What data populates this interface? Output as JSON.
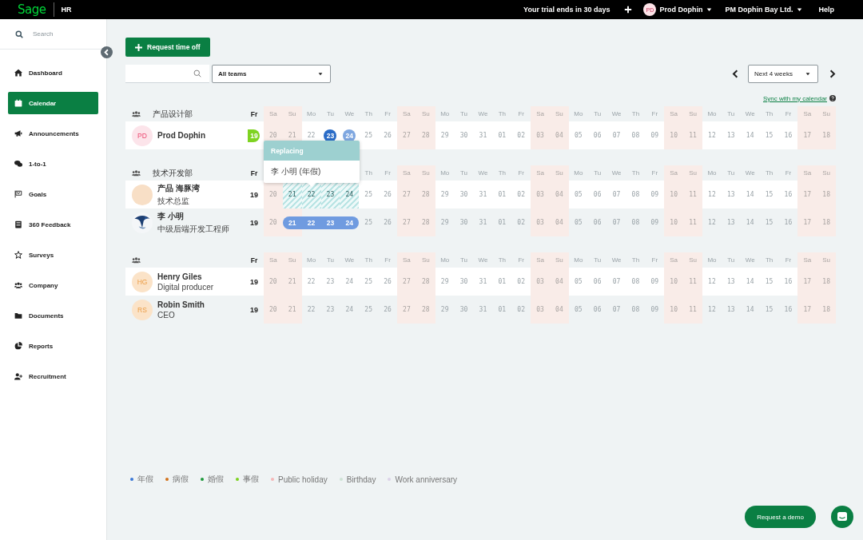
{
  "topbar": {
    "logo": "Sage",
    "product": "HR",
    "trial": "Your trial ends in 30 days",
    "user": {
      "initials": "PD",
      "name": "Prod Dophin"
    },
    "company": "PM Dophin Bay Ltd.",
    "help": "Help"
  },
  "sidebar": {
    "search_placeholder": "Search",
    "items": [
      {
        "label": "Dashboard",
        "kind": "home",
        "selected": false
      },
      {
        "label": "Calendar",
        "kind": "calendar",
        "selected": true
      },
      {
        "label": "Announcements",
        "kind": "megaphone",
        "selected": false
      },
      {
        "label": "1-to-1",
        "kind": "chat",
        "selected": false
      },
      {
        "label": "Goals",
        "kind": "flag",
        "selected": false
      },
      {
        "label": "360 Feedback",
        "kind": "doc",
        "selected": false
      },
      {
        "label": "Surveys",
        "kind": "star",
        "selected": false
      },
      {
        "label": "Company",
        "kind": "people",
        "selected": false
      },
      {
        "label": "Documents",
        "kind": "folder",
        "selected": false
      },
      {
        "label": "Reports",
        "kind": "pie",
        "selected": false
      },
      {
        "label": "Recruitment",
        "kind": "adduser",
        "selected": false
      }
    ]
  },
  "toolbar": {
    "request_button": "Request time off",
    "team_select": "All teams",
    "range_select": "Next 4 weeks",
    "sync_link": "Sync with my calendar"
  },
  "teams": [
    {
      "name": "产品设计部",
      "weekdays": [
        {
          "label": "Fr",
          "weekend": false,
          "today": true
        },
        {
          "label": "Sa",
          "weekend": true,
          "today": false
        },
        {
          "label": "Su",
          "weekend": true,
          "today": false
        },
        {
          "label": "Mo",
          "weekend": false,
          "today": false
        },
        {
          "label": "Tu",
          "weekend": false,
          "today": false
        },
        {
          "label": "We",
          "weekend": false,
          "today": false
        },
        {
          "label": "Th",
          "weekend": false,
          "today": false
        },
        {
          "label": "Fr",
          "weekend": false,
          "today": false
        },
        {
          "label": "Sa",
          "weekend": true,
          "today": false
        },
        {
          "label": "Su",
          "weekend": true,
          "today": false
        },
        {
          "label": "Mo",
          "weekend": false,
          "today": false
        },
        {
          "label": "Tu",
          "weekend": false,
          "today": false
        },
        {
          "label": "We",
          "weekend": false,
          "today": false
        },
        {
          "label": "Th",
          "weekend": false,
          "today": false
        },
        {
          "label": "Fr",
          "weekend": false,
          "today": false
        },
        {
          "label": "Sa",
          "weekend": true,
          "today": false
        },
        {
          "label": "Su",
          "weekend": true,
          "today": false
        },
        {
          "label": "Mo",
          "weekend": false,
          "today": false
        },
        {
          "label": "Tu",
          "weekend": false,
          "today": false
        },
        {
          "label": "We",
          "weekend": false,
          "today": false
        },
        {
          "label": "Th",
          "weekend": false,
          "today": false
        },
        {
          "label": "Fr",
          "weekend": false,
          "today": false
        },
        {
          "label": "Sa",
          "weekend": true,
          "today": false
        },
        {
          "label": "Su",
          "weekend": true,
          "today": false
        },
        {
          "label": "Mo",
          "weekend": false,
          "today": false
        },
        {
          "label": "Tu",
          "weekend": false,
          "today": false
        },
        {
          "label": "We",
          "weekend": false,
          "today": false
        },
        {
          "label": "Th",
          "weekend": false,
          "today": false
        },
        {
          "label": "Fr",
          "weekend": false,
          "today": false
        },
        {
          "label": "Sa",
          "weekend": true,
          "today": false
        },
        {
          "label": "Su",
          "weekend": true,
          "today": false
        }
      ],
      "members": [
        {
          "name": "Prod Dophin",
          "avatar": {
            "kind": "initials",
            "initials": "PD",
            "color": "#fce4ea"
          },
          "days": [
            {
              "date": "19",
              "kind": "half",
              "color": "#7ed321"
            },
            {
              "date": "20",
              "kind": "plain"
            },
            {
              "date": "21",
              "kind": "plain"
            },
            {
              "date": "22",
              "kind": "plain"
            },
            {
              "date": "23",
              "kind": "circle",
              "color": "#2a6cc7"
            },
            {
              "date": "24",
              "kind": "circle",
              "color": "#7fa7e0"
            },
            {
              "date": "25",
              "kind": "plain"
            },
            {
              "date": "26",
              "kind": "plain"
            },
            {
              "date": "27",
              "kind": "plain"
            },
            {
              "date": "28",
              "kind": "plain"
            },
            {
              "date": "29",
              "kind": "plain"
            },
            {
              "date": "30",
              "kind": "plain"
            },
            {
              "date": "31",
              "kind": "plain"
            },
            {
              "date": "01",
              "kind": "plain"
            },
            {
              "date": "02",
              "kind": "plain"
            },
            {
              "date": "03",
              "kind": "plain"
            },
            {
              "date": "04",
              "kind": "plain"
            },
            {
              "date": "05",
              "kind": "plain"
            },
            {
              "date": "06",
              "kind": "plain"
            },
            {
              "date": "07",
              "kind": "plain"
            },
            {
              "date": "08",
              "kind": "plain"
            },
            {
              "date": "09",
              "kind": "plain"
            },
            {
              "date": "10",
              "kind": "plain"
            },
            {
              "date": "11",
              "kind": "plain"
            },
            {
              "date": "12",
              "kind": "plain"
            },
            {
              "date": "13",
              "kind": "plain"
            },
            {
              "date": "14",
              "kind": "plain"
            },
            {
              "date": "15",
              "kind": "plain"
            },
            {
              "date": "16",
              "kind": "plain"
            },
            {
              "date": "17",
              "kind": "plain"
            },
            {
              "date": "18",
              "kind": "plain"
            }
          ]
        }
      ]
    },
    {
      "name": "技术开发部",
      "weekdays": [
        {
          "label": "Fr",
          "weekend": false,
          "today": true
        },
        {
          "label": "Th",
          "weekend": false,
          "today": false
        },
        {
          "label": "Fr",
          "weekend": false,
          "today": false
        },
        {
          "label": "Sa",
          "weekend": true,
          "today": false
        },
        {
          "label": "Su",
          "weekend": true,
          "today": false
        },
        {
          "label": "Mo",
          "weekend": false,
          "today": false
        },
        {
          "label": "Tu",
          "weekend": false,
          "today": false
        },
        {
          "label": "We",
          "weekend": false,
          "today": false
        },
        {
          "label": "Th",
          "weekend": false,
          "today": false
        },
        {
          "label": "Fr",
          "weekend": false,
          "today": false
        },
        {
          "label": "Sa",
          "weekend": true,
          "today": false
        },
        {
          "label": "Su",
          "weekend": true,
          "today": false
        },
        {
          "label": "Mo",
          "weekend": false,
          "today": false
        },
        {
          "label": "Tu",
          "weekend": false,
          "today": false
        },
        {
          "label": "We",
          "weekend": false,
          "today": false
        },
        {
          "label": "Th",
          "weekend": false,
          "today": false
        },
        {
          "label": "Fr",
          "weekend": false,
          "today": false
        },
        {
          "label": "Sa",
          "weekend": true,
          "today": false
        },
        {
          "label": "Su",
          "weekend": true,
          "today": false
        },
        {
          "label": "Mo",
          "weekend": false,
          "today": false
        },
        {
          "label": "Tu",
          "weekend": false,
          "today": false
        },
        {
          "label": "We",
          "weekend": false,
          "today": false
        },
        {
          "label": "Th",
          "weekend": false,
          "today": false
        },
        {
          "label": "Fr",
          "weekend": false,
          "today": false
        },
        {
          "label": "Sa",
          "weekend": true,
          "today": false
        },
        {
          "label": "Su",
          "weekend": true,
          "today": false
        }
      ],
      "members": [
        {
          "name": "产品 海豚湾",
          "role": "技术总监",
          "avatar": {
            "kind": "blank",
            "color": "#f8dfc6"
          },
          "days": [
            {
              "date": "19",
              "kind": "plain"
            },
            {
              "date": "20",
              "kind": "plain"
            },
            {
              "date": "21",
              "kind": "replacing"
            },
            {
              "date": "22",
              "kind": "replacing"
            },
            {
              "date": "23",
              "kind": "replacing"
            },
            {
              "date": "24",
              "kind": "replacing"
            },
            {
              "date": "25",
              "kind": "plain"
            },
            {
              "date": "26",
              "kind": "plain"
            },
            {
              "date": "27",
              "kind": "plain"
            },
            {
              "date": "28",
              "kind": "plain"
            },
            {
              "date": "29",
              "kind": "plain"
            },
            {
              "date": "30",
              "kind": "plain"
            },
            {
              "date": "31",
              "kind": "plain"
            },
            {
              "date": "01",
              "kind": "plain"
            },
            {
              "date": "02",
              "kind": "plain"
            },
            {
              "date": "03",
              "kind": "plain"
            },
            {
              "date": "04",
              "kind": "plain"
            },
            {
              "date": "05",
              "kind": "plain"
            },
            {
              "date": "06",
              "kind": "plain"
            },
            {
              "date": "07",
              "kind": "plain"
            },
            {
              "date": "08",
              "kind": "plain"
            },
            {
              "date": "09",
              "kind": "plain"
            },
            {
              "date": "10",
              "kind": "plain"
            },
            {
              "date": "11",
              "kind": "plain"
            },
            {
              "date": "12",
              "kind": "plain"
            },
            {
              "date": "13",
              "kind": "plain"
            },
            {
              "date": "14",
              "kind": "plain"
            },
            {
              "date": "15",
              "kind": "plain"
            },
            {
              "date": "16",
              "kind": "plain"
            },
            {
              "date": "17",
              "kind": "plain"
            },
            {
              "date": "18",
              "kind": "plain"
            }
          ]
        },
        {
          "name": "李 小明",
          "role": "中级后端开发工程师",
          "days": [
            {
              "date": "19",
              "kind": "plain"
            },
            {
              "date": "20",
              "kind": "plain"
            },
            {
              "date": "21",
              "kind": "pill",
              "color": "#6f9be0"
            },
            {
              "date": "22",
              "kind": "pill",
              "color": "#6f9be0"
            },
            {
              "date": "23",
              "kind": "pill",
              "color": "#6f9be0"
            },
            {
              "date": "24",
              "kind": "pill",
              "color": "#6f9be0"
            },
            {
              "date": "25",
              "kind": "plain"
            },
            {
              "date": "26",
              "kind": "plain"
            },
            {
              "date": "27",
              "kind": "plain"
            },
            {
              "date": "28",
              "kind": "plain"
            },
            {
              "date": "29",
              "kind": "plain"
            },
            {
              "date": "30",
              "kind": "plain"
            },
            {
              "date": "31",
              "kind": "plain"
            },
            {
              "date": "01",
              "kind": "plain"
            },
            {
              "date": "02",
              "kind": "plain"
            },
            {
              "date": "03",
              "kind": "plain"
            },
            {
              "date": "04",
              "kind": "plain"
            },
            {
              "date": "05",
              "kind": "plain"
            },
            {
              "date": "06",
              "kind": "plain"
            },
            {
              "date": "07",
              "kind": "plain"
            },
            {
              "date": "08",
              "kind": "plain"
            },
            {
              "date": "09",
              "kind": "plain"
            },
            {
              "date": "10",
              "kind": "plain"
            },
            {
              "date": "11",
              "kind": "plain"
            },
            {
              "date": "12",
              "kind": "plain"
            },
            {
              "date": "13",
              "kind": "plain"
            },
            {
              "date": "14",
              "kind": "plain"
            },
            {
              "date": "15",
              "kind": "plain"
            },
            {
              "date": "16",
              "kind": "plain"
            },
            {
              "date": "17",
              "kind": "plain"
            },
            {
              "date": "18",
              "kind": "plain"
            }
          ]
        }
      ]
    },
    {
      "weekdays": [
        {
          "label": "Fr",
          "weekend": false,
          "today": true
        },
        {
          "label": "Sa",
          "weekend": true,
          "today": false
        },
        {
          "label": "Su",
          "weekend": true,
          "today": false
        },
        {
          "label": "Mo",
          "weekend": false,
          "today": false
        },
        {
          "label": "Tu",
          "weekend": false,
          "today": false
        },
        {
          "label": "We",
          "weekend": false,
          "today": false
        },
        {
          "label": "Th",
          "weekend": false,
          "today": false
        },
        {
          "label": "Fr",
          "weekend": false,
          "today": false
        },
        {
          "label": "Sa",
          "weekend": true,
          "today": false
        },
        {
          "label": "Su",
          "weekend": true,
          "today": false
        },
        {
          "label": "Mo",
          "weekend": false,
          "today": false
        },
        {
          "label": "Tu",
          "weekend": false,
          "today": false
        },
        {
          "label": "We",
          "weekend": false,
          "today": false
        },
        {
          "label": "Th",
          "weekend": false,
          "today": false
        },
        {
          "label": "Fr",
          "weekend": false,
          "today": false
        },
        {
          "label": "Sa",
          "weekend": true,
          "today": false
        },
        {
          "label": "Su",
          "weekend": true,
          "today": false
        },
        {
          "label": "Mo",
          "weekend": false,
          "today": false
        },
        {
          "label": "Tu",
          "weekend": false,
          "today": false
        },
        {
          "label": "We",
          "weekend": false,
          "today": false
        },
        {
          "label": "Th",
          "weekend": false,
          "today": false
        },
        {
          "label": "Fr",
          "weekend": false,
          "today": false
        },
        {
          "label": "Sa",
          "weekend": true,
          "today": false
        },
        {
          "label": "Su",
          "weekend": true,
          "today": false
        },
        {
          "label": "Mo",
          "weekend": false,
          "today": false
        },
        {
          "label": "Tu",
          "weekend": false,
          "today": false
        },
        {
          "label": "We",
          "weekend": false,
          "today": false
        },
        {
          "label": "Th",
          "weekend": false,
          "today": false
        },
        {
          "label": "Fr",
          "weekend": false,
          "today": false
        },
        {
          "label": "Sa",
          "weekend": true,
          "today": false
        },
        {
          "label": "Su",
          "weekend": true,
          "today": false
        }
      ],
      "members": [
        {
          "name": "Henry Giles",
          "role": "Digital producer",
          "avatar": {
            "kind": "initials",
            "initials": "HG",
            "color": "#fbe3c8"
          },
          "days": [
            {
              "date": "19",
              "kind": "plain"
            },
            {
              "date": "20",
              "kind": "plain"
            },
            {
              "date": "21",
              "kind": "plain"
            },
            {
              "date": "22",
              "kind": "plain"
            },
            {
              "date": "23",
              "kind": "plain"
            },
            {
              "date": "24",
              "kind": "plain"
            },
            {
              "date": "25",
              "kind": "plain"
            },
            {
              "date": "26",
              "kind": "plain"
            },
            {
              "date": "27",
              "kind": "plain"
            },
            {
              "date": "28",
              "kind": "plain"
            },
            {
              "date": "29",
              "kind": "plain"
            },
            {
              "date": "30",
              "kind": "plain"
            },
            {
              "date": "31",
              "kind": "plain"
            },
            {
              "date": "01",
              "kind": "plain"
            },
            {
              "date": "02",
              "kind": "plain"
            },
            {
              "date": "03",
              "kind": "plain"
            },
            {
              "date": "04",
              "kind": "plain"
            },
            {
              "date": "05",
              "kind": "plain"
            },
            {
              "date": "06",
              "kind": "plain"
            },
            {
              "date": "07",
              "kind": "plain"
            },
            {
              "date": "08",
              "kind": "plain"
            },
            {
              "date": "09",
              "kind": "plain"
            },
            {
              "date": "10",
              "kind": "plain"
            },
            {
              "date": "11",
              "kind": "plain"
            },
            {
              "date": "12",
              "kind": "plain"
            },
            {
              "date": "13",
              "kind": "plain"
            },
            {
              "date": "14",
              "kind": "plain"
            },
            {
              "date": "15",
              "kind": "plain"
            },
            {
              "date": "16",
              "kind": "plain"
            },
            {
              "date": "17",
              "kind": "plain"
            },
            {
              "date": "18",
              "kind": "plain"
            }
          ]
        },
        {
          "name": "Robin Smith",
          "role": "CEO",
          "avatar": {
            "kind": "initials",
            "initials": "RS",
            "color": "#fbe3c8"
          },
          "days": [
            {
              "date": "19",
              "kind": "plain"
            },
            {
              "date": "20",
              "kind": "plain"
            },
            {
              "date": "21",
              "kind": "plain"
            },
            {
              "date": "22",
              "kind": "plain"
            },
            {
              "date": "23",
              "kind": "plain"
            },
            {
              "date": "24",
              "kind": "plain"
            },
            {
              "date": "25",
              "kind": "plain"
            },
            {
              "date": "26",
              "kind": "plain"
            },
            {
              "date": "27",
              "kind": "plain"
            },
            {
              "date": "28",
              "kind": "plain"
            },
            {
              "date": "29",
              "kind": "plain"
            },
            {
              "date": "30",
              "kind": "plain"
            },
            {
              "date": "31",
              "kind": "plain"
            },
            {
              "date": "01",
              "kind": "plain"
            },
            {
              "date": "02",
              "kind": "plain"
            },
            {
              "date": "03",
              "kind": "plain"
            },
            {
              "date": "04",
              "kind": "plain"
            },
            {
              "date": "05",
              "kind": "plain"
            },
            {
              "date": "06",
              "kind": "plain"
            },
            {
              "date": "07",
              "kind": "plain"
            },
            {
              "date": "08",
              "kind": "plain"
            },
            {
              "date": "09",
              "kind": "plain"
            },
            {
              "date": "10",
              "kind": "plain"
            },
            {
              "date": "11",
              "kind": "plain"
            },
            {
              "date": "12",
              "kind": "plain"
            },
            {
              "date": "13",
              "kind": "plain"
            },
            {
              "date": "14",
              "kind": "plain"
            },
            {
              "date": "15",
              "kind": "plain"
            },
            {
              "date": "16",
              "kind": "plain"
            },
            {
              "date": "17",
              "kind": "plain"
            },
            {
              "date": "18",
              "kind": "plain"
            }
          ]
        }
      ]
    }
  ],
  "popover": {
    "title": "Replacing",
    "text": "李 小明 (年假)"
  },
  "legend": [
    {
      "label": "年假",
      "color": "#3a78d6"
    },
    {
      "label": "病假",
      "color": "#d2731e"
    },
    {
      "label": "婚假",
      "color": "#1e9a3c"
    },
    {
      "label": "事假",
      "color": "#7ed321"
    },
    {
      "label": "Public holiday",
      "color": "#f5b8b8"
    },
    {
      "label": "Birthday",
      "color": "#cfe3d6"
    },
    {
      "label": "Work anniversary",
      "color": "#dcd3e8"
    }
  ],
  "demo_button": "Request a demo"
}
